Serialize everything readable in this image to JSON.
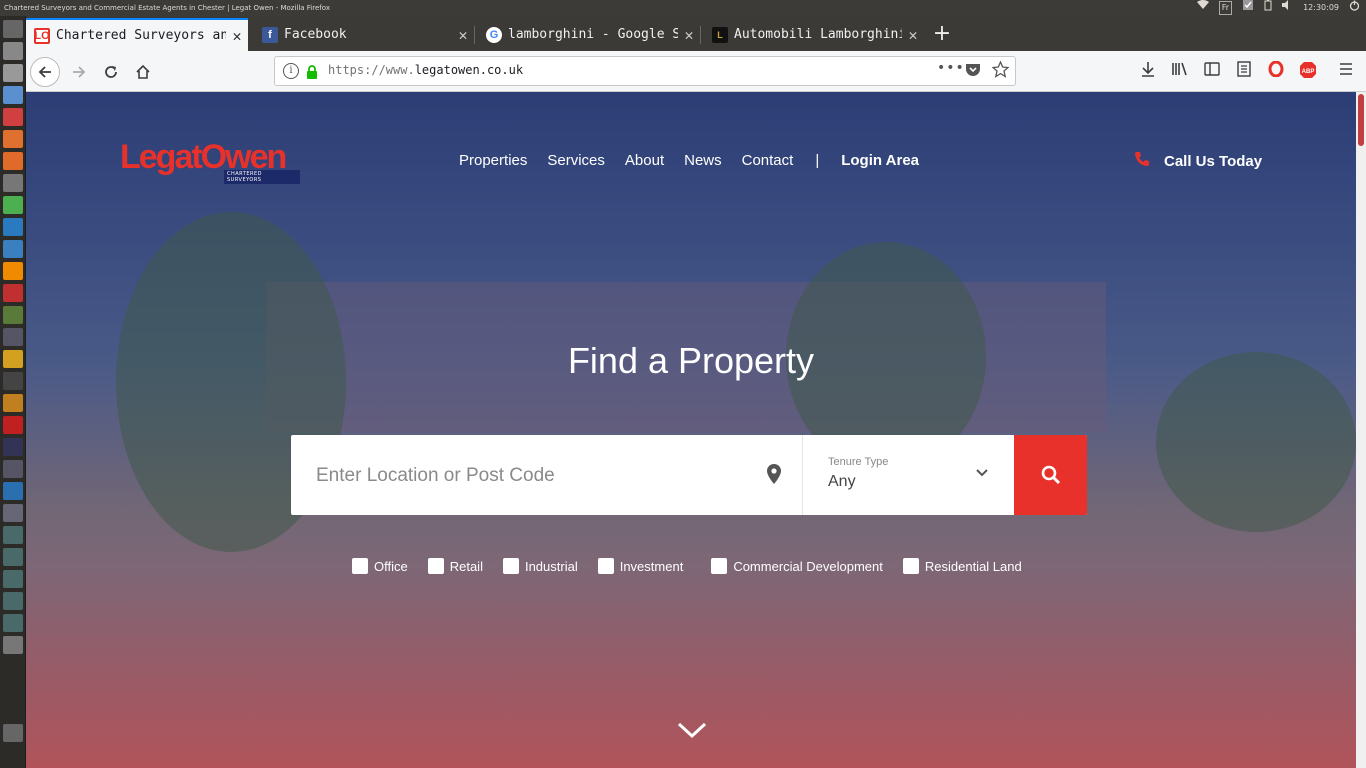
{
  "os": {
    "window_title": "Chartered Surveyors and Commercial Estate Agents in Chester | Legat Owen - Mozilla Firefox",
    "keyboard_layout": "Fr",
    "clock": "12:30:09"
  },
  "browser": {
    "tabs": [
      {
        "title": "Chartered Surveyors and",
        "active": true,
        "favicon": "LO"
      },
      {
        "title": "Facebook",
        "active": false,
        "favicon": "f"
      },
      {
        "title": "lamborghini - Google Sea",
        "active": false,
        "favicon": "G"
      },
      {
        "title": "Automobili Lamborghini",
        "active": false,
        "favicon": "L"
      }
    ],
    "url_scheme": "https://www.",
    "url_host": "legatowen.co.uk",
    "url_menu": "•••"
  },
  "site": {
    "logo_text": "LegatOwen",
    "logo_sub": "CHARTERED SURVEYORS",
    "nav": [
      "Properties",
      "Services",
      "About",
      "News",
      "Contact"
    ],
    "nav_sep": "|",
    "login": "Login Area",
    "call": "Call Us Today",
    "hero_title": "Find a Property",
    "search_placeholder": "Enter Location or Post Code",
    "tenure_label": "Tenure Type",
    "tenure_value": "Any",
    "categories": [
      "Office",
      "Retail",
      "Industrial",
      "Investment",
      "Commercial Development",
      "Residential Land"
    ]
  },
  "colors": {
    "accent": "#e8312a",
    "brand_blue": "#1c2a6a"
  }
}
